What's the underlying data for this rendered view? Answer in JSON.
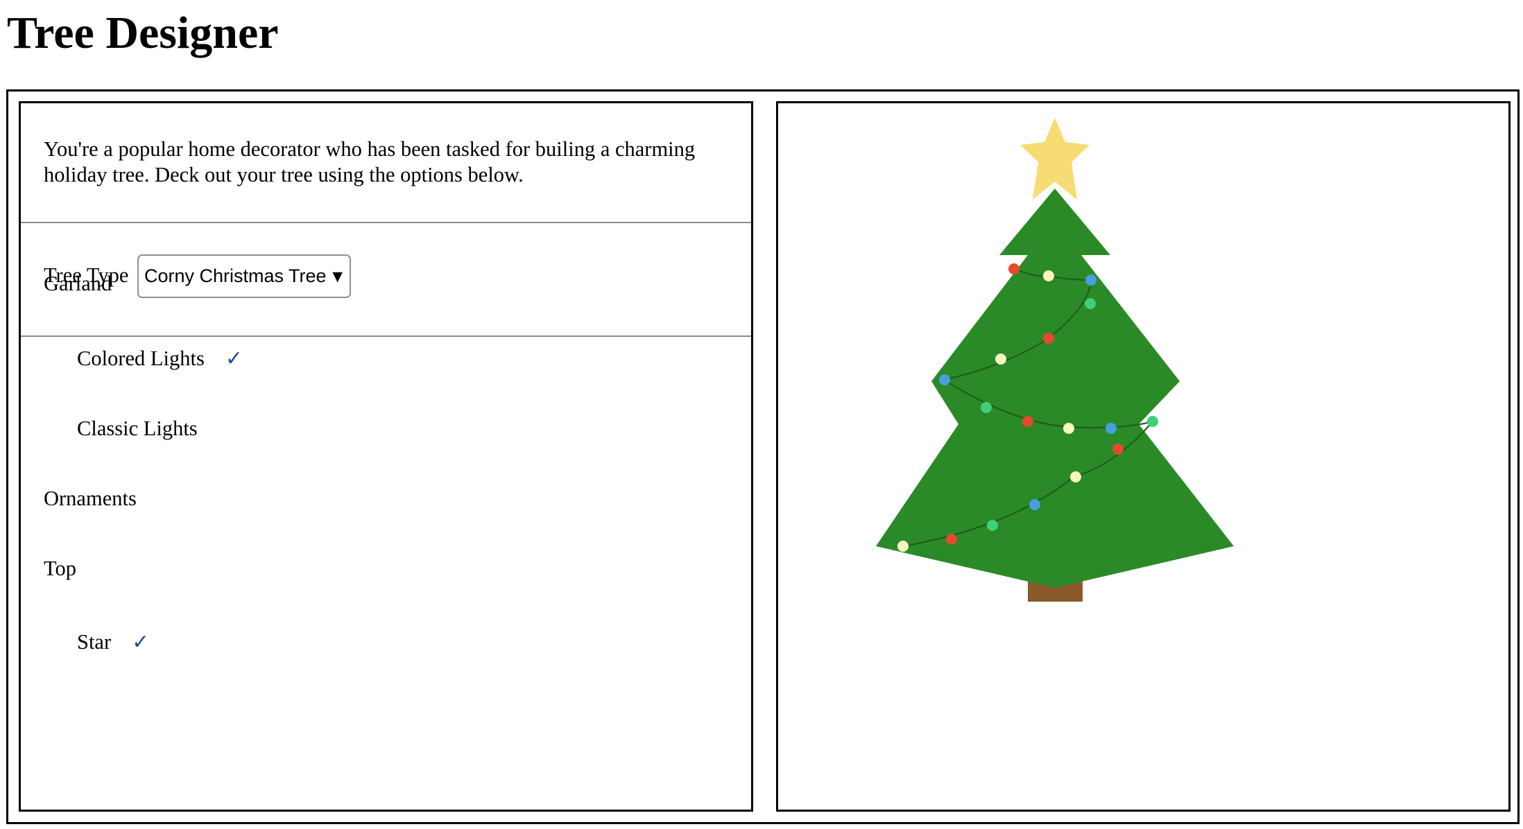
{
  "page": {
    "title": "Tree Designer"
  },
  "intro": {
    "text": "You're a popular home decorator who has been tasked for builing a charming holiday tree. Deck out your tree using the options below."
  },
  "tree_type": {
    "label": "Tree Type",
    "selected": "Corny Christmas Tree"
  },
  "options": {
    "garland": {
      "heading": "Garland",
      "items": [
        {
          "label": "Colored Lights",
          "selected": true
        },
        {
          "label": "Classic Lights",
          "selected": false
        }
      ]
    },
    "ornaments": {
      "heading": "Ornaments",
      "items": []
    },
    "top": {
      "heading": "Top",
      "items": [
        {
          "label": "Star",
          "selected": true
        }
      ]
    }
  },
  "preview": {
    "tree_color": "#2a8a27",
    "trunk_color": "#8b5a2b",
    "star_color": "#f7dc73",
    "garland_wire_color": "#1f5e1c",
    "light_colors": {
      "red": "#e8492e",
      "yellow": "#fbf6c0",
      "blue": "#4a9ee0",
      "green": "#3ecf78"
    }
  }
}
